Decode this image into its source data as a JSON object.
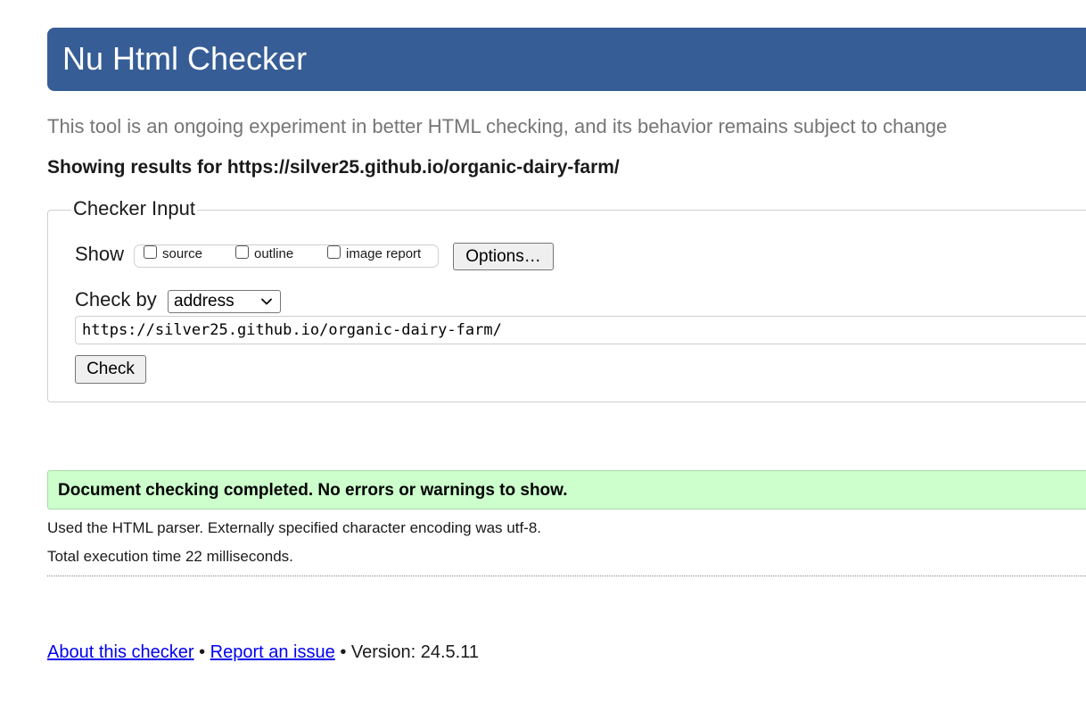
{
  "header": {
    "title": "Nu Html Checker"
  },
  "tagline": "This tool is an ongoing experiment in better HTML checking, and its behavior remains subject to change",
  "results_for": "Showing results for https://silver25.github.io/organic-dairy-farm/",
  "checker_input": {
    "legend": "Checker Input",
    "show_label": "Show",
    "show_options": [
      {
        "label": "source",
        "checked": false
      },
      {
        "label": "outline",
        "checked": false
      },
      {
        "label": "image report",
        "checked": false
      }
    ],
    "options_button": "Options…",
    "check_by_label": "Check by",
    "check_by_selected": "address",
    "url_value": "https://silver25.github.io/organic-dairy-farm/",
    "check_button": "Check"
  },
  "result": {
    "success_message": "Document checking completed. No errors or warnings to show.",
    "parser_info": "Used the HTML parser. Externally specified character encoding was utf-8.",
    "execution_time": "Total execution time 22 milliseconds."
  },
  "footer": {
    "about_link": "About this checker",
    "separator": "•",
    "report_link": "Report an issue",
    "version": "Version: 24.5.11"
  },
  "colors": {
    "banner": "#365d95",
    "success_bg": "#ccffcc",
    "link": "#0000ee"
  },
  "icons": {
    "select_chevron": "chevron-down-icon"
  }
}
